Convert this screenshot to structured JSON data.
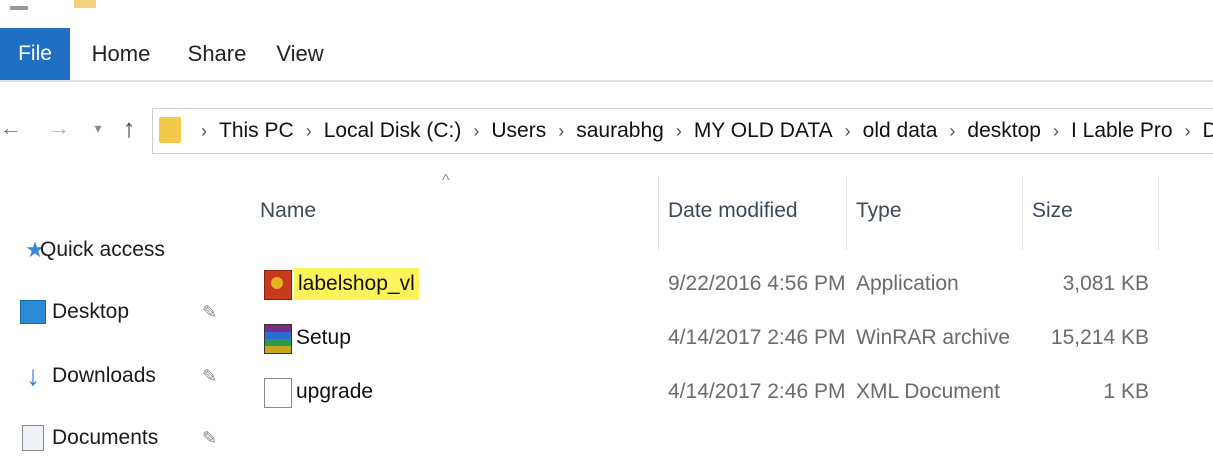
{
  "ribbon": {
    "tabs": [
      "File",
      "Home",
      "Share",
      "View"
    ]
  },
  "nav": {
    "back_icon": "back-arrow-icon",
    "forward_icon": "forward-arrow-icon",
    "recent_icon": "chevron-down-icon",
    "up_icon": "up-arrow-icon",
    "breadcrumbs": [
      "This PC",
      "Local Disk (C:)",
      "Users",
      "saurabhg",
      "MY OLD DATA",
      "old data",
      "desktop",
      "I Lable Pro",
      "Driver v"
    ]
  },
  "sidebar": {
    "items": [
      {
        "label": "Quick access",
        "icon": "star-icon"
      },
      {
        "label": "Desktop",
        "icon": "desktop-icon",
        "pinned": true
      },
      {
        "label": "Downloads",
        "icon": "download-arrow-icon",
        "pinned": true
      },
      {
        "label": "Documents",
        "icon": "documents-icon",
        "pinned": true
      }
    ]
  },
  "filelist": {
    "sort_indicator": "^",
    "columns": {
      "name": "Name",
      "date": "Date modified",
      "type": "Type",
      "size": "Size"
    },
    "rows": [
      {
        "name": "labelshop_vl",
        "date": "9/22/2016 4:56 PM",
        "type": "Application",
        "size": "3,081 KB",
        "icon": "application-icon",
        "highlighted": true
      },
      {
        "name": "Setup",
        "date": "4/14/2017 2:46 PM",
        "type": "WinRAR archive",
        "size": "15,214 KB",
        "icon": "winrar-archive-icon"
      },
      {
        "name": "upgrade",
        "date": "4/14/2017 2:46 PM",
        "type": "XML Document",
        "size": "1 KB",
        "icon": "xml-document-icon"
      }
    ]
  },
  "colors": {
    "file_tab": "#1f6fc5",
    "highlight": "#fff35a",
    "folder": "#f5c94c"
  }
}
